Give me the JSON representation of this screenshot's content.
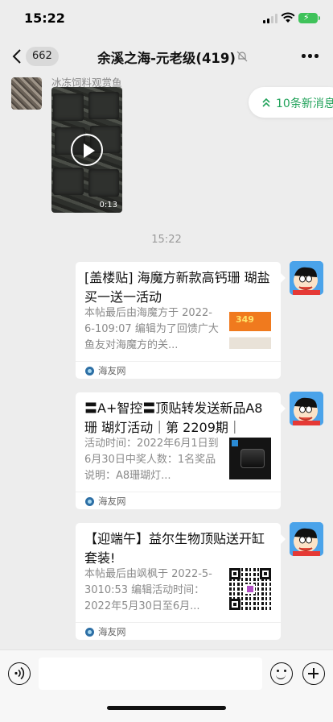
{
  "status_bar": {
    "time": "15:22"
  },
  "nav": {
    "unread_count": "662",
    "title": "余溪之海-元老级(419)"
  },
  "messages": {
    "sender_name": "冰冻饲料观赏鱼",
    "video_duration": "0:13",
    "new_messages_label": "10条新消息",
    "timestamp": "15:22"
  },
  "cards": [
    {
      "title": "[盖楼贴] 海魔方新款高钙珊 瑚盐买一送一活动",
      "desc": "本帖最后由海魔方于 2022-6-109:07 编辑为了回馈广大鱼友对海魔方的关...",
      "thumb_text": "349",
      "source": "海友网"
    },
    {
      "title": "〓A+智控〓顶贴转发送新品A8珊 瑚灯活动｜第 2209期｜",
      "desc": "活动时间：2022年6月1日到6月30日中奖人数：1名奖品说明：A8珊瑚灯...",
      "source": "海友网"
    },
    {
      "title": "【迎端午】益尔生物顶贴送开缸套装!",
      "desc": "本帖最后由飒枫于 2022-5-3010:53 编辑活动时间：2022年5月30日至6月...",
      "source": "海友网"
    }
  ],
  "input_bar": {
    "placeholder": ""
  },
  "colors": {
    "accent_green": "#21a25a",
    "background": "#ededed"
  }
}
